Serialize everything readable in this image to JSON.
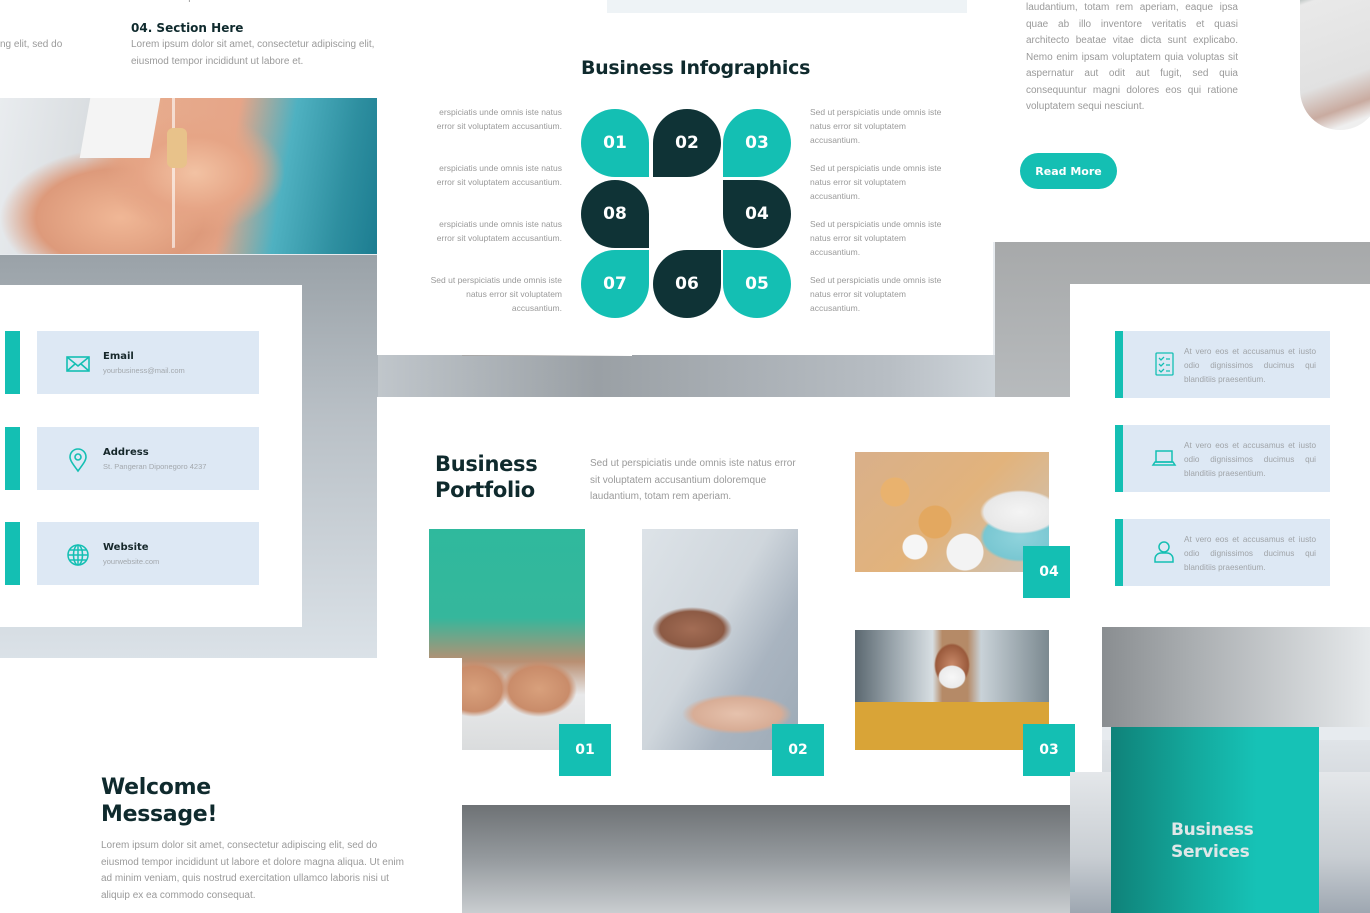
{
  "colors": {
    "accent_teal": "#14bfb3",
    "dark_teal": "#0f3336",
    "card_blue": "#dde8f4",
    "heading": "#0f2a2d",
    "body_text": "#9a9a9a"
  },
  "slide_sections": {
    "cut_text": "eiusmod tempor incididunt ut labore et.",
    "left_fragment": "ng elit, sed do",
    "section_title": "04. Section Here",
    "section_text": "Lorem ipsum dolor sit amet, consectetur adipiscing elit, sed do eiusmod tempor incididunt ut labore et.",
    "photo": "iv-drip-hand-photo"
  },
  "slide_infographics": {
    "title": "Business Infographics",
    "petals": [
      {
        "label": "01",
        "color": "teal"
      },
      {
        "label": "02",
        "color": "dark"
      },
      {
        "label": "03",
        "color": "teal"
      },
      {
        "label": "04",
        "color": "dark"
      },
      {
        "label": "05",
        "color": "teal"
      },
      {
        "label": "06",
        "color": "dark"
      },
      {
        "label": "07",
        "color": "teal"
      },
      {
        "label": "08",
        "color": "dark"
      }
    ],
    "left_texts": [
      "erspiciatis unde omnis iste natus error sit voluptatem accusantium.",
      "erspiciatis unde omnis iste natus error sit voluptatem accusantium.",
      "erspiciatis unde omnis iste natus error sit voluptatem accusantium.",
      "Sed ut perspiciatis unde omnis iste natus error sit voluptatem accusantium."
    ],
    "right_texts": [
      "Sed ut perspiciatis unde omnis iste natus error sit voluptatem accusantium.",
      "Sed ut perspiciatis unde omnis iste natus error sit voluptatem accusantium.",
      "Sed ut perspiciatis unde omnis iste natus error sit voluptatem accusantium.",
      "Sed ut perspiciatis unde omnis iste natus error sit voluptatem accusantium."
    ]
  },
  "slide_readmore": {
    "paragraph": "laudantium, totam rem aperiam, eaque ipsa quae ab illo inventore veritatis et quasi architecto beatae vitae dicta sunt explicabo. Nemo enim ipsam voluptatem quia voluptas sit aspernatur aut odit aut fugit, sed quia consequuntur magni dolores eos qui ratione voluptatem sequi nesciunt.",
    "button_label": "Read More",
    "photo": "laptop-photo"
  },
  "slide_contact": {
    "items": [
      {
        "icon": "mail-icon",
        "label": "Email",
        "value": "yourbusiness@mail.com"
      },
      {
        "icon": "location-pin-icon",
        "label": "Address",
        "value": "St. Pangeran Diponegoro 4237"
      },
      {
        "icon": "globe-icon",
        "label": "Website",
        "value": "yourwebsite.com"
      }
    ]
  },
  "slide_portfolio": {
    "title_line1": "Business",
    "title_line2": "Portfolio",
    "description": "Sed ut perspiciatis unde omnis iste natus error sit voluptatem accusantium doloremque laudantium, totam rem aperiam.",
    "items": [
      {
        "badge": "01",
        "photo": "doctor-offering-pills-photo"
      },
      {
        "badge": "02",
        "photo": "hand-sanitizer-photo"
      },
      {
        "badge": "03",
        "photo": "woman-with-face-mask-photo"
      },
      {
        "badge": "04",
        "photo": "assorted-pills-photo"
      }
    ]
  },
  "slide_services": {
    "items": [
      {
        "icon": "checklist-icon",
        "text": "At vero eos et accusamus et iusto odio dignissimos ducimus qui blanditiis praesentium."
      },
      {
        "icon": "laptop-icon",
        "text": "At vero eos et accusamus et iusto odio dignissimos ducimus qui blanditiis praesentium."
      },
      {
        "icon": "user-icon",
        "text": "At vero eos et accusamus et iusto odio dignissimos ducimus qui blanditiis praesentium."
      }
    ]
  },
  "slide_welcome": {
    "title_line1": "Welcome",
    "title_line2": "Message!",
    "paragraph": "Lorem ipsum dolor sit amet, consectetur adipiscing elit, sed do eiusmod tempor incididunt ut labore et dolore magna aliqua. Ut enim ad minim veniam, quis nostrud exercitation ullamco laboris nisi ut aliquip ex ea commodo consequat."
  },
  "slide_bizserv": {
    "title_line1": "Business",
    "title_line2": "Services"
  }
}
